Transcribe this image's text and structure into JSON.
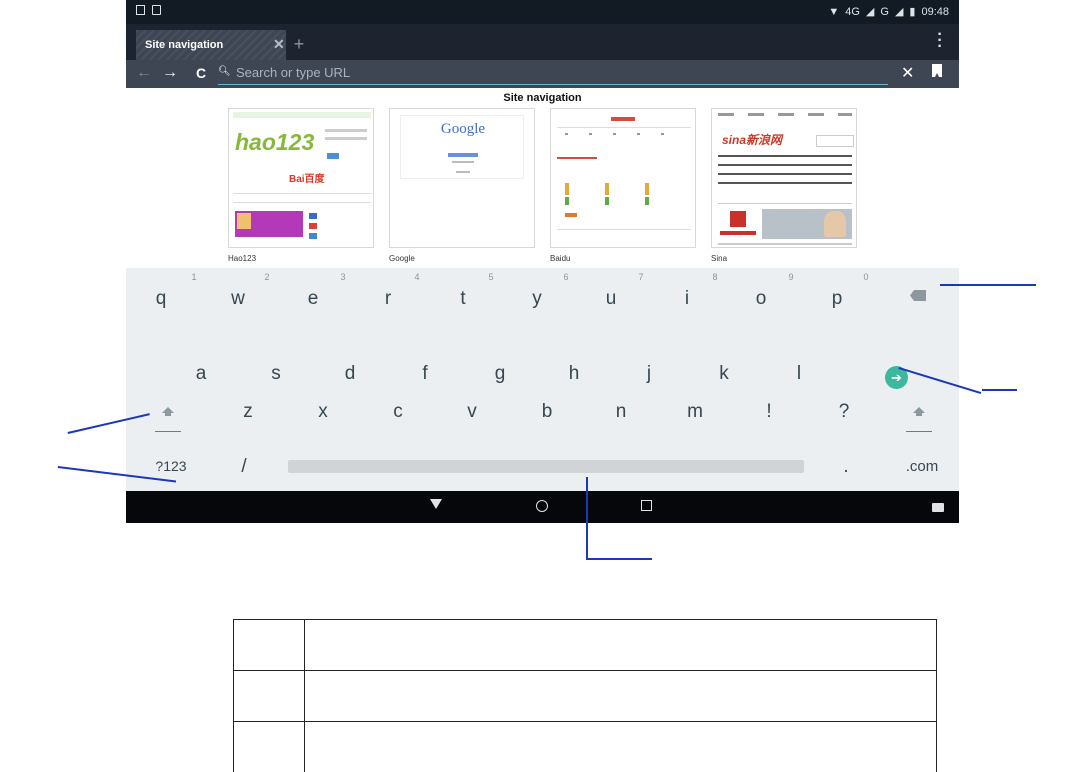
{
  "status_bar": {
    "network": "4G",
    "network2": "G",
    "time": "09:48"
  },
  "tabs": [
    {
      "title": "Site navigation"
    }
  ],
  "url_bar": {
    "placeholder": "Search or type URL"
  },
  "page": {
    "title": "Site navigation",
    "thumbnails": [
      {
        "label": "Hao123",
        "logo": "hao123",
        "logo_sub": "Bai百度"
      },
      {
        "label": "Google",
        "logo": "Google"
      },
      {
        "label": "Baidu"
      },
      {
        "label": "Sina",
        "logo": "sina新浪网"
      }
    ]
  },
  "keyboard": {
    "row1": [
      {
        "key": "q",
        "hint": "1"
      },
      {
        "key": "w",
        "hint": "2"
      },
      {
        "key": "e",
        "hint": "3"
      },
      {
        "key": "r",
        "hint": "4"
      },
      {
        "key": "t",
        "hint": "5"
      },
      {
        "key": "y",
        "hint": "6"
      },
      {
        "key": "u",
        "hint": "7"
      },
      {
        "key": "i",
        "hint": "8"
      },
      {
        "key": "o",
        "hint": "9"
      },
      {
        "key": "p",
        "hint": "0"
      }
    ],
    "row2": [
      "a",
      "s",
      "d",
      "f",
      "g",
      "h",
      "j",
      "k",
      "l"
    ],
    "row3": [
      "z",
      "x",
      "c",
      "v",
      "b",
      "n",
      "m",
      "!",
      "?"
    ],
    "symbols_key": "?123",
    "slash_key": "/",
    "period_key": ".",
    "dotcom_key": ".com",
    "go_key": "➔"
  },
  "table": {
    "rows": [
      [
        "",
        ""
      ],
      [
        "",
        ""
      ],
      [
        "",
        ""
      ]
    ]
  },
  "colors": {
    "accent_go": "#3cb89c",
    "callout": "#1a38b8",
    "url_underline": "#67b8cf"
  }
}
